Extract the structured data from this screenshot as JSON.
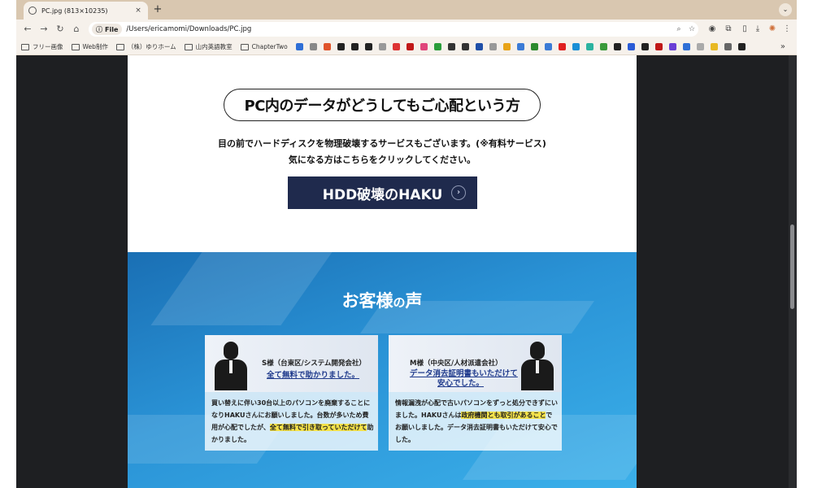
{
  "browser": {
    "tab_title": "PC.jpg (813×10235)",
    "close_glyph": "×",
    "newtab_glyph": "+",
    "tabmenu_glyph": "⌄",
    "back_glyph": "←",
    "forward_glyph": "→",
    "reload_glyph": "↻",
    "home_glyph": "⌂",
    "chip_icon": "ⓘ",
    "chip_label": "File",
    "url": "/Users/ericamomi/Downloads/PC.jpg",
    "zoom_glyph": "⌕",
    "star_glyph": "☆",
    "more_glyph": "⋮",
    "bm_more_glyph": "»"
  },
  "bookmarks": {
    "folders": [
      "フリー画像",
      "Web制作",
      "（株）ゆりホーム",
      "山内英語教室",
      "ChapterTwo"
    ],
    "icon_colors": [
      "#2f6fd6",
      "#888",
      "#e0542b",
      "#222",
      "#222",
      "#222",
      "#999",
      "#d33",
      "#c01818",
      "#e0457b",
      "#2a9d3a",
      "#333",
      "#333",
      "#1f4fa8",
      "#999",
      "#e8a317",
      "#3b7bd6",
      "#2d8a2d",
      "#3b7bd6",
      "#e02020",
      "#1a8fd6",
      "#2bb3a0",
      "#3a9a3a",
      "#222",
      "#2a5bd6",
      "#222",
      "#c01818",
      "#6a3fd6",
      "#2f6fd6",
      "#aaa",
      "#e8b923",
      "#666",
      "#222"
    ]
  },
  "page": {
    "heading": "PC内のデータがどうしてもご心配という方",
    "desc_line1": "目の前でハードディスクを物理破壊するサービスもございます。(※有料サービス)",
    "desc_line2": "気になる方はこちらをクリックしてください。",
    "hdd_button": "HDD破壊のHAKU",
    "hdd_button_arrow": "›",
    "voice_title_main": "お客様",
    "voice_title_small": "の",
    "voice_title_end": "声"
  },
  "testimonials": [
    {
      "name": "S様（台東区/システム開発会社）",
      "catch": "全て無料で助かりました。",
      "body_a": "買い替えに伴い30台以上のパソコンを廃棄することになりHAKUさんにお願いしました。台数が多いため費用が心配でしたが、",
      "body_hl1": "全て無料で引き取っていただけて",
      "body_b": "助かりました。"
    },
    {
      "name": "M様（中央区/人材派遣会社）",
      "catch": "データ消去証明書もいただけて",
      "catch2": "安心でした。",
      "body_a": "情報漏洩が心配で古いパソコンをずっと処分できずにいました。HAKUさんは",
      "body_hl1": "政府機関とも取引があること",
      "body_b": "でお願いしました。データ消去証明書もいただけて安心でした。"
    }
  ]
}
